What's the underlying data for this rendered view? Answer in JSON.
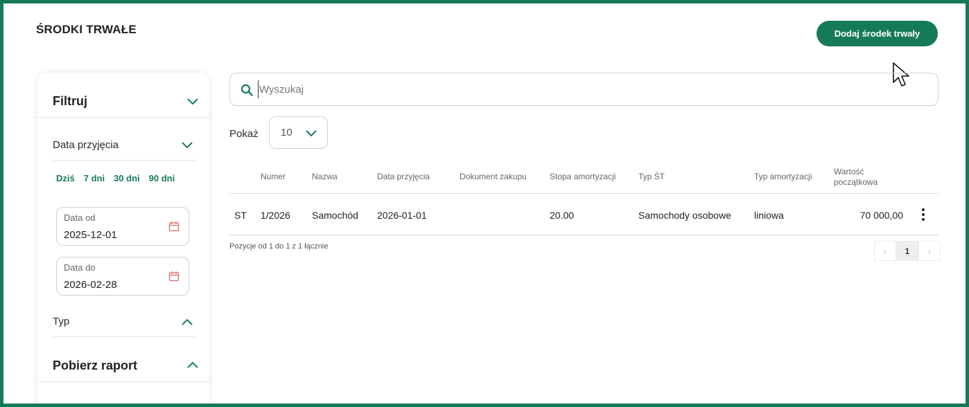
{
  "header": {
    "title": "ŚRODKI TRWAŁE",
    "add_button": "Dodaj środek trwały"
  },
  "sidebar": {
    "filter_title": "Filtruj",
    "date_section": "Data przyjęcia",
    "quick_ranges": [
      "Dziś",
      "7 dni",
      "30 dni",
      "90 dni"
    ],
    "date_from": {
      "label": "Data od",
      "value": "2025-12-01"
    },
    "date_to": {
      "label": "Data do",
      "value": "2026-02-28"
    },
    "type_section": "Typ",
    "report_title": "Pobierz raport"
  },
  "search": {
    "placeholder": "Wyszukaj"
  },
  "page_size": {
    "label": "Pokaż",
    "value": "10"
  },
  "table": {
    "columns": [
      "Numer",
      "Nazwa",
      "Data przyjęcia",
      "Dokument zakupu",
      "Stopa amortyzacji",
      "Typ ŚT",
      "Typ amortyzacji",
      "Wartość początkowa"
    ],
    "rows": [
      {
        "prefix": "ST",
        "numer": "1/2026",
        "nazwa": "Samochód",
        "data": "2026-01-01",
        "dokument": "",
        "stopa": "20.00",
        "typ_st": "Samochody osobowe",
        "typ_amort": "liniowa",
        "wartosc": "70 000,00"
      }
    ],
    "footer": "Pozycje od 1 do 1 z 1 łącznie"
  },
  "pagination": {
    "prev": "‹",
    "current": "1",
    "next": "›"
  },
  "colors": {
    "accent": "#157a5a",
    "calendar_icon": "#e06a6a"
  },
  "icons": [
    "chevron-down-icon",
    "chevron-up-icon",
    "calendar-icon",
    "search-icon",
    "more-vertical-icon",
    "mouse-cursor-icon"
  ]
}
